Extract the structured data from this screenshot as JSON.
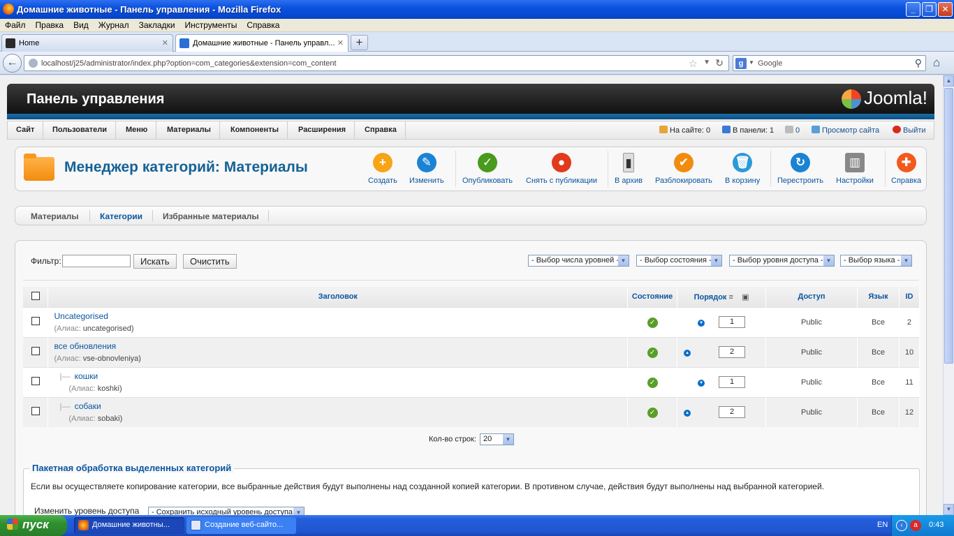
{
  "window": {
    "title": "Домашние животные - Панель управления - Mozilla Firefox"
  },
  "menubar": [
    "Файл",
    "Правка",
    "Вид",
    "Журнал",
    "Закладки",
    "Инструменты",
    "Справка"
  ],
  "tabs": [
    {
      "label": "Home"
    },
    {
      "label": "Домашние животные - Панель управл..."
    }
  ],
  "nav": {
    "url": "localhost/j25/administrator/index.php?option=com_categories&extension=com_content",
    "search_placeholder": "Google"
  },
  "admin": {
    "header_title": "Панель управления",
    "logo_text": "Joomla!",
    "topmenu": [
      "Сайт",
      "Пользователи",
      "Меню",
      "Материалы",
      "Компоненты",
      "Расширения",
      "Справка"
    ],
    "status": {
      "on_site": "На сайте: 0",
      "in_panel": "В панели: 1",
      "messages": "0",
      "view_site": "Просмотр сайта",
      "logout": "Выйти"
    },
    "page_title": "Менеджер категорий: Материалы",
    "toolbar": [
      {
        "label": "Создать",
        "icon": "add-icon",
        "color": "#f7a516",
        "glyph": "+"
      },
      {
        "label": "Изменить",
        "icon": "edit-icon",
        "color": "#1a83d4",
        "glyph": "✎"
      },
      {
        "label": "Опубликовать",
        "icon": "publish-icon",
        "color": "#4a9a1e",
        "glyph": "✓"
      },
      {
        "label": "Снять с публикации",
        "icon": "unpublish-icon",
        "color": "#e23a1c",
        "glyph": "●"
      },
      {
        "label": "В архив",
        "icon": "archive-icon",
        "color": "#dddddd",
        "glyph": "▮"
      },
      {
        "label": "Разблокировать",
        "icon": "checkin-icon",
        "color": "#f28c0f",
        "glyph": "✔"
      },
      {
        "label": "В корзину",
        "icon": "trash-icon",
        "color": "#2a9ad8",
        "glyph": "🗑"
      },
      {
        "label": "Перестроить",
        "icon": "refresh-icon",
        "color": "#1a83d4",
        "glyph": "↻"
      },
      {
        "label": "Настройки",
        "icon": "options-icon",
        "color": "#888888",
        "glyph": "▥"
      },
      {
        "label": "Справка",
        "icon": "help-icon",
        "color": "#f25a1c",
        "glyph": "✚"
      }
    ],
    "subnav": [
      "Материалы",
      "Категории",
      "Избранные материалы"
    ],
    "filter": {
      "label": "Фильтр:",
      "value": "",
      "search_button": "Искать",
      "clear_button": "Очистить",
      "selects": [
        "- Выбор числа уровней -",
        "- Выбор состояния -",
        "- Выбор уровня доступа -",
        "- Выбор языка -"
      ]
    },
    "table": {
      "headers": {
        "title": "Заголовок",
        "status": "Состояние",
        "order": "Порядок",
        "access": "Доступ",
        "language": "Язык",
        "id": "ID"
      },
      "alias_label": "(Алиас:",
      "rows": [
        {
          "title": "Uncategorised",
          "alias": "uncategorised)",
          "order": "1",
          "access": "Public",
          "language": "Все",
          "id": "2",
          "level": 1,
          "arrow": "down"
        },
        {
          "title": "все обновления",
          "alias": "vse-obnovleniya)",
          "order": "2",
          "access": "Public",
          "language": "Все",
          "id": "10",
          "level": 1,
          "arrow": "up"
        },
        {
          "title": "кошки",
          "alias": "koshki)",
          "order": "1",
          "access": "Public",
          "language": "Все",
          "id": "11",
          "level": 2,
          "arrow": "down"
        },
        {
          "title": "собаки",
          "alias": "sobaki)",
          "order": "2",
          "access": "Public",
          "language": "Все",
          "id": "12",
          "level": 2,
          "arrow": "up"
        }
      ]
    },
    "rows_per_page": {
      "label": "Кол-во строк:",
      "value": "20"
    },
    "batch": {
      "legend": "Пакетная обработка выделенных категорий",
      "description": "Если вы осуществляете копирование категории, все выбранные действия будут выполнены над созданной копией категории. В противном случае, действия будут выполнены над выбранной категорией.",
      "access_label": "Изменить уровень доступа",
      "access_select": "- Сохранить исходный уровень доступа -"
    }
  },
  "taskbar": {
    "start": "пуск",
    "tasks": [
      "Домашние животны...",
      "Создание веб-сайто..."
    ],
    "lang": "EN",
    "clock": "0:43"
  }
}
